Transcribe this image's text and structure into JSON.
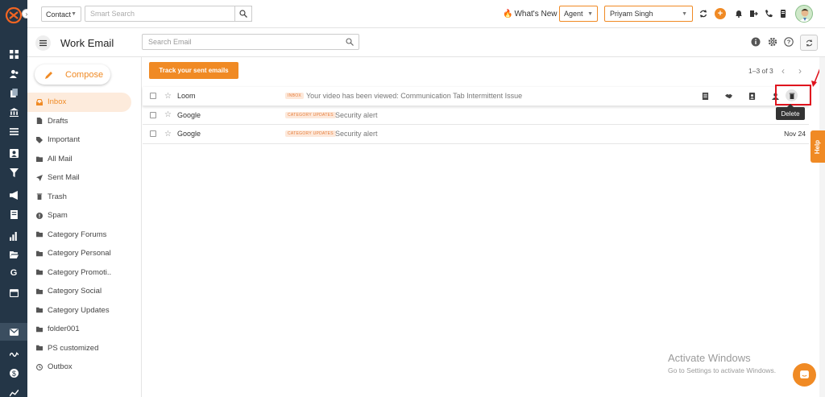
{
  "header": {
    "contact_type": "Contact",
    "smart_search_placeholder": "Smart Search",
    "whats_new": "What's New",
    "agent_status": "Agent",
    "user_name": "Priyam Singh"
  },
  "subheader": {
    "title": "Work Email",
    "search_placeholder": "Search Email"
  },
  "compose_label": "Compose",
  "folders": [
    {
      "label": "Inbox",
      "icon": "inbox-icon",
      "active": true
    },
    {
      "label": "Drafts",
      "icon": "file-icon"
    },
    {
      "label": "Important",
      "icon": "tag-icon"
    },
    {
      "label": "All Mail",
      "icon": "all-mail-icon"
    },
    {
      "label": "Sent Mail",
      "icon": "send-icon"
    },
    {
      "label": "Trash",
      "icon": "trash-icon"
    },
    {
      "label": "Spam",
      "icon": "spam-icon"
    },
    {
      "label": "Category Forums",
      "icon": "folder-icon"
    },
    {
      "label": "Category Personal",
      "icon": "folder-icon"
    },
    {
      "label": "Category Promoti..",
      "icon": "folder-icon"
    },
    {
      "label": "Category Social",
      "icon": "folder-icon"
    },
    {
      "label": "Category Updates",
      "icon": "folder-icon"
    },
    {
      "label": "folder001",
      "icon": "folder-icon"
    },
    {
      "label": "PS customized",
      "icon": "folder-icon"
    },
    {
      "label": "Outbox",
      "icon": "clock-icon"
    }
  ],
  "main": {
    "track_button": "Track your sent emails",
    "pagination": "1–3 of 3",
    "emails": [
      {
        "sender": "Loom",
        "tag": "INBOX",
        "subject": "Your video has been viewed: Communication Tab Intermittent Issue",
        "date": ""
      },
      {
        "sender": "Google",
        "tag": "CATEGORY UPDATES",
        "subject": "Security alert",
        "date": ""
      },
      {
        "sender": "Google",
        "tag": "CATEGORY UPDATES",
        "subject": "Security alert",
        "date": "Nov 24"
      }
    ],
    "delete_tooltip": "Delete"
  },
  "help_label": "Help",
  "watermark": {
    "line1": "Activate Windows",
    "line2": "Go to Settings to activate Windows."
  },
  "colors": {
    "accent": "#f08a24",
    "rail": "#243647",
    "highlight_box": "#e0141e"
  }
}
